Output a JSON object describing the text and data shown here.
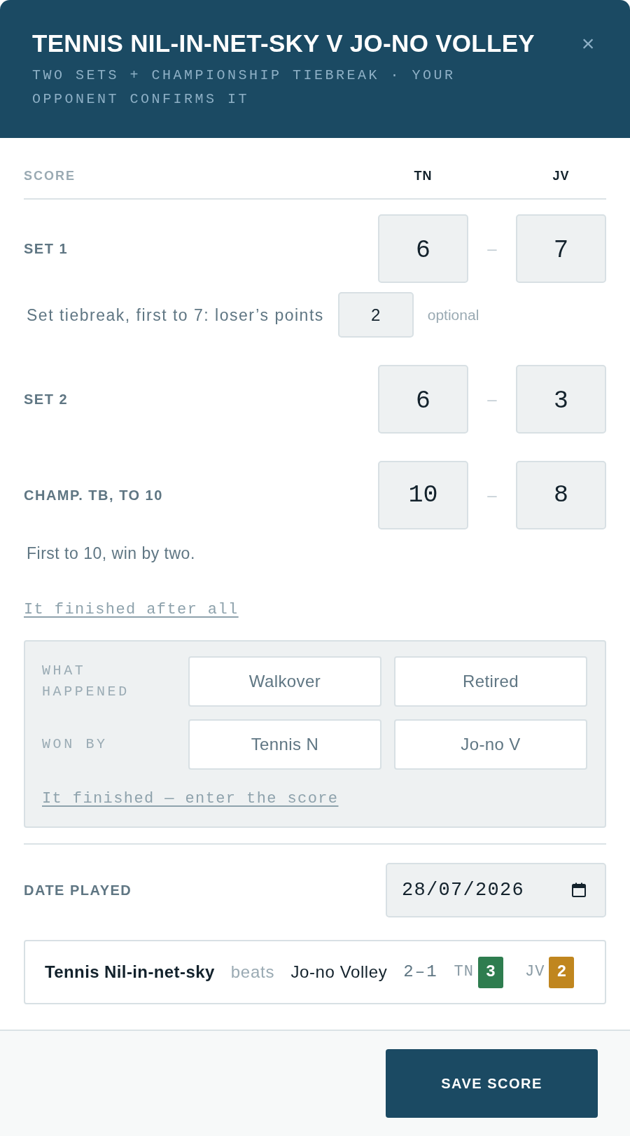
{
  "dialog": {
    "title": "TENNIS NIL-IN-NET-SKY V JO-NO VOLLEY",
    "subtitle": "TWO SETS + CHAMPIONSHIP TIEBREAK · YOUR OPPONENT CONFIRMS IT",
    "close": "×"
  },
  "score_header": {
    "label": "SCORE",
    "players": [
      "TN",
      "JV"
    ]
  },
  "rows": [
    {
      "kind": "set",
      "label": "SET 1",
      "scores": [
        "6",
        "7"
      ],
      "separator": "–",
      "tiebreak": {
        "label": "Set tiebreak, first to 7: loser’s points",
        "value": "2",
        "hint": "optional"
      }
    },
    {
      "kind": "set",
      "label": "SET 2",
      "scores": [
        "6",
        "3"
      ],
      "separator": "–"
    },
    {
      "kind": "champ",
      "label": "CHAMP. TB, TO 10",
      "scores": [
        "10",
        "8"
      ],
      "separator": "–",
      "note": "First to 10, win by two."
    }
  ],
  "finish_link": "It finished after all",
  "incomplete": {
    "fields": [
      {
        "label": "WHAT HAPPENED",
        "options": [
          {
            "label": "Walkover",
            "selected": false
          },
          {
            "label": "Retired",
            "selected": false
          }
        ]
      },
      {
        "label": "WON BY",
        "options": [
          {
            "label": "Tennis N",
            "selected": false
          },
          {
            "label": "Jo-no V",
            "selected": false
          }
        ]
      }
    ],
    "link": "It finished — enter the score"
  },
  "date": {
    "label": "DATE PLAYED",
    "value": "28/07/2026"
  },
  "summary": {
    "winner": "Tennis Nil-in-net-sky",
    "verb": "beats",
    "loser": "Jo-no Volley",
    "sets": "2–1",
    "points": [
      {
        "code": "TN",
        "value": "3",
        "color": "#2e7d4f"
      },
      {
        "code": "JV",
        "value": "2",
        "color": "#c0861f"
      }
    ]
  },
  "save_button": "SAVE SCORE"
}
